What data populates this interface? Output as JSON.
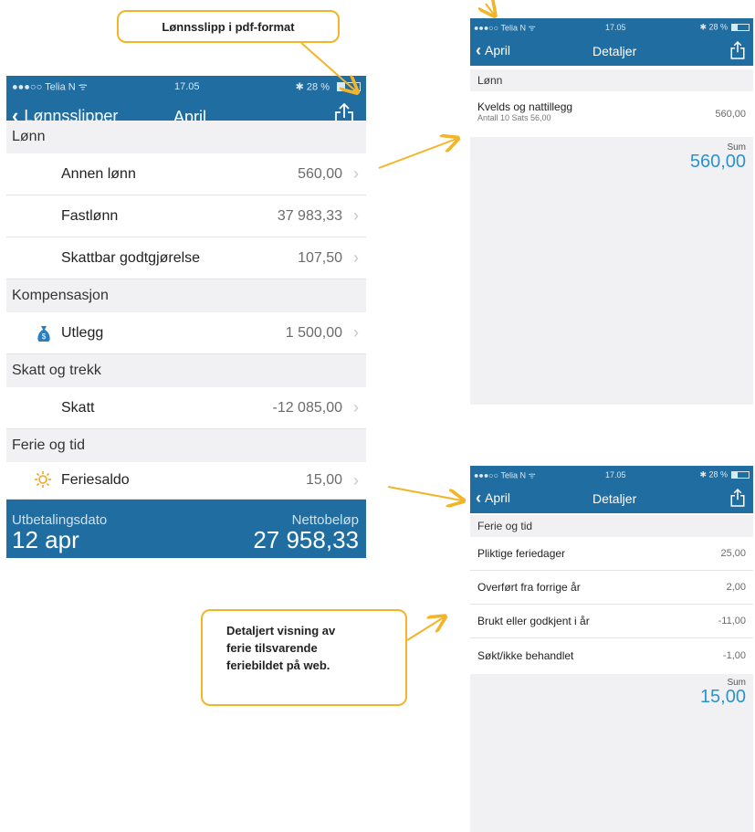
{
  "callouts": {
    "pdf": "Lønnsslipp i pdf-format",
    "ferie_lines": [
      "Detaljert visning av",
      "ferie tilsvarende",
      "feriebildet på web."
    ]
  },
  "main": {
    "status": {
      "carrier": "●●●○○ Telia N ᯤ",
      "time": "17.05",
      "battery": "✱ 28 %"
    },
    "nav": {
      "back": "Lønnsslipper",
      "title": "April"
    },
    "sections": {
      "lonn": "Lønn",
      "kompensasjon": "Kompensasjon",
      "skatt": "Skatt og trekk",
      "ferie": "Ferie og tid"
    },
    "rows": {
      "annen_lonn": {
        "label": "Annen lønn",
        "value": "560,00"
      },
      "fastlonn": {
        "label": "Fastlønn",
        "value": "37 983,33"
      },
      "skattbar": {
        "label": "Skattbar godtgjørelse",
        "value": "107,50"
      },
      "utlegg": {
        "label": "Utlegg",
        "value": "1 500,00"
      },
      "skatt": {
        "label": "Skatt",
        "value": "-12 085,00"
      },
      "feriesaldo": {
        "label": "Feriesaldo",
        "value": "15,00"
      }
    },
    "footer": {
      "date_label": "Utbetalingsdato",
      "date_value": "12 apr",
      "net_label": "Nettobeløp",
      "net_value": "27 958,33"
    }
  },
  "detail1": {
    "status": {
      "carrier": "●●●○○ Telia N ᯤ",
      "time": "17.05",
      "battery": "✱ 28 %"
    },
    "nav": {
      "back": "April",
      "title": "Detaljer"
    },
    "section": "Lønn",
    "row": {
      "label": "Kvelds og nattillegg",
      "sub": "Antall 10 Sats 56,00",
      "value": "560,00"
    },
    "sum_label": "Sum",
    "sum_value": "560,00"
  },
  "detail2": {
    "status": {
      "carrier": "●●●○○ Telia N ᯤ",
      "time": "17.05",
      "battery": "✱ 28 %"
    },
    "nav": {
      "back": "April",
      "title": "Detaljer"
    },
    "section": "Ferie og tid",
    "rows": [
      {
        "label": "Pliktige feriedager",
        "value": "25,00"
      },
      {
        "label": "Overført fra forrige år",
        "value": "2,00"
      },
      {
        "label": "Brukt eller godkjent i år",
        "value": "-11,00"
      },
      {
        "label": "Søkt/ikke behandlet",
        "value": "-1,00"
      }
    ],
    "sum_label": "Sum",
    "sum_value": "15,00"
  },
  "colors": {
    "brand_blue": "#1f6da1",
    "accent_orange": "#f3b428",
    "sum_blue": "#2a93cf",
    "negative_red": "#d0214f"
  }
}
